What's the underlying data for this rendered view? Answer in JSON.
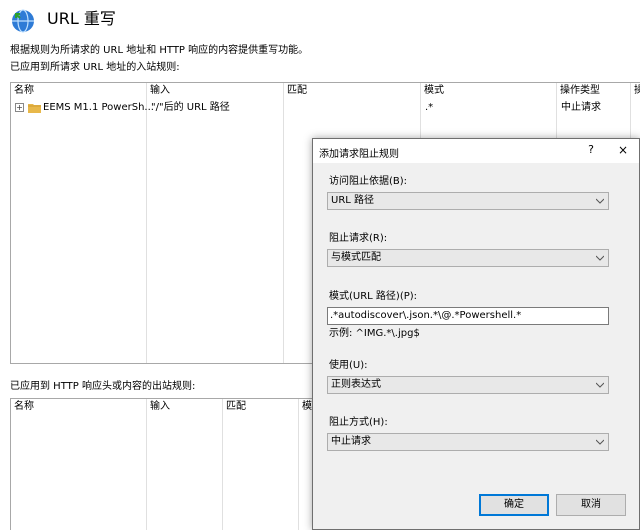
{
  "header": {
    "title": "URL 重写",
    "description": "根据规则为所请求的 URL 地址和 HTTP 响应的内容提供重写功能。"
  },
  "inbound": {
    "section_label": "已应用到所请求 URL 地址的入站规则:",
    "columns": [
      "名称",
      "输入",
      "匹配",
      "模式",
      "操作类型",
      "操"
    ],
    "rows": [
      {
        "name": "EEMS M1.1 PowerSh...",
        "input": "\"/\"后的 URL 路径",
        "match": "",
        "pattern": ".*",
        "action": "中止请求"
      }
    ]
  },
  "outbound": {
    "section_label": "已应用到 HTTP 响应头或内容的出站规则:",
    "columns": [
      "名称",
      "输入",
      "匹配",
      "模"
    ]
  },
  "dialog": {
    "title": "添加请求阻止规则",
    "help": "?",
    "close": "×",
    "block_access_label": "访问阻止依据(B):",
    "block_access_value": "URL 路径",
    "block_request_label": "阻止请求(R):",
    "block_request_value": "与模式匹配",
    "pattern_label": "模式(URL 路径)(P):",
    "pattern_value": ".*autodiscover\\.json.*\\@.*Powershell.*",
    "example": "示例: ^IMG.*\\.jpg$",
    "using_label": "使用(U):",
    "using_value": "正则表达式",
    "how_label": "阻止方式(H):",
    "how_value": "中止请求",
    "ok_label": "确定",
    "cancel_label": "取消"
  },
  "colors": {
    "dialog_bg": "#f0f0f0",
    "default_button_border": "#0078d7",
    "folder": "#e8b84a"
  }
}
